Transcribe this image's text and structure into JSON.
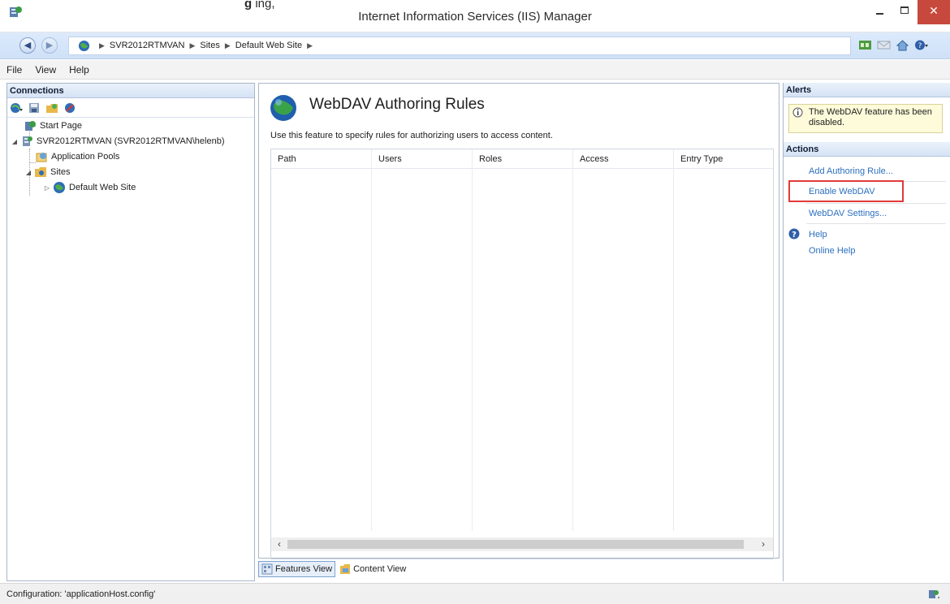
{
  "window": {
    "title": "Internet Information Services (IIS) Manager",
    "title_fragment": "g",
    "title_fragment_rest": " ing,"
  },
  "address": {
    "crumbs": [
      "SVR2012RTMVAN",
      "Sites",
      "Default Web Site"
    ]
  },
  "menu": [
    "File",
    "View",
    "Help"
  ],
  "connections": {
    "header": "Connections",
    "tree": [
      {
        "label": "Start Page",
        "icon": "start-page-icon"
      },
      {
        "label": "SVR2012RTMVAN (SVR2012RTMVAN\\helenb)",
        "icon": "server-icon"
      },
      {
        "label": "Application Pools",
        "icon": "app-pools-icon"
      },
      {
        "label": "Sites",
        "icon": "sites-folder-icon"
      },
      {
        "label": "Default Web Site",
        "icon": "web-site-globe-icon"
      }
    ]
  },
  "feature": {
    "title": "WebDAV Authoring Rules",
    "description": "Use this feature to specify rules for authorizing users to access content.",
    "columns": [
      "Path",
      "Users",
      "Roles",
      "Access",
      "Entry Type"
    ]
  },
  "view_tabs": {
    "features": "Features View",
    "content": "Content View"
  },
  "alerts": {
    "header": "Alerts",
    "message": "The WebDAV feature has been disabled."
  },
  "actions": {
    "header": "Actions",
    "add_rule": "Add Authoring Rule...",
    "enable": "Enable WebDAV",
    "settings": "WebDAV Settings...",
    "help": "Help",
    "online_help": "Online Help"
  },
  "status": {
    "text": "Configuration: 'applicationHost.config'"
  },
  "colors": {
    "link": "#2c6fbe",
    "highlight": "#e23a3a",
    "close_button": "#c7493d",
    "pane_header": "#d5e3f5"
  }
}
